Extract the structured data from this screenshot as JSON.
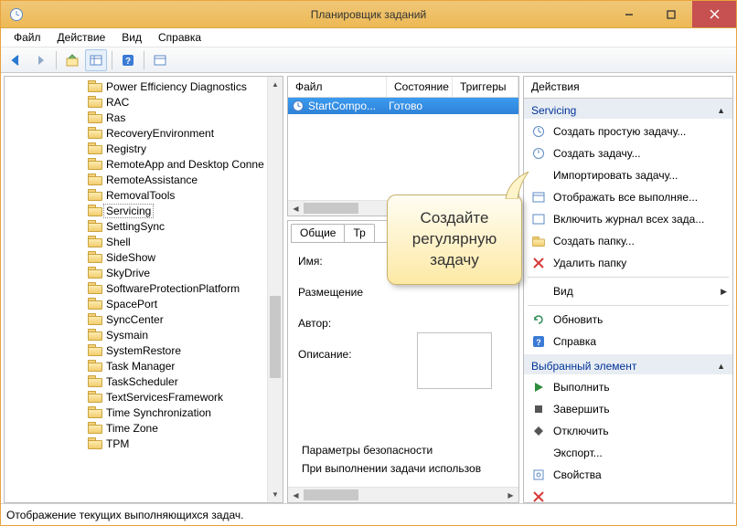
{
  "window": {
    "title": "Планировщик заданий"
  },
  "menu": {
    "file": "Файл",
    "action": "Действие",
    "view": "Вид",
    "help": "Справка"
  },
  "tree": {
    "items": [
      {
        "label": "Power Efficiency Diagnostics"
      },
      {
        "label": "RAC"
      },
      {
        "label": "Ras"
      },
      {
        "label": "RecoveryEnvironment"
      },
      {
        "label": "Registry"
      },
      {
        "label": "RemoteApp and Desktop Conne"
      },
      {
        "label": "RemoteAssistance"
      },
      {
        "label": "RemovalTools"
      },
      {
        "label": "Servicing",
        "selected": true
      },
      {
        "label": "SettingSync"
      },
      {
        "label": "Shell"
      },
      {
        "label": "SideShow"
      },
      {
        "label": "SkyDrive"
      },
      {
        "label": "SoftwareProtectionPlatform"
      },
      {
        "label": "SpacePort"
      },
      {
        "label": "SyncCenter"
      },
      {
        "label": "Sysmain"
      },
      {
        "label": "SystemRestore"
      },
      {
        "label": "Task Manager"
      },
      {
        "label": "TaskScheduler"
      },
      {
        "label": "TextServicesFramework"
      },
      {
        "label": "Time Synchronization"
      },
      {
        "label": "Time Zone"
      },
      {
        "label": "TPM"
      }
    ]
  },
  "task_list": {
    "columns": {
      "file": "Файл",
      "state": "Состояние",
      "triggers": "Триггеры"
    },
    "rows": [
      {
        "name": "StartCompo...",
        "state": "Готово"
      }
    ]
  },
  "tabs": {
    "general": "Общие",
    "triggers": "Тр"
  },
  "details": {
    "name_label": "Имя:",
    "location_label": "Размещение",
    "author_label": "Автор:",
    "description_label": "Описание:",
    "security_label": "Параметры безопасности",
    "security_sub": "При выполнении задачи использов"
  },
  "actions": {
    "header": "Действия",
    "group1": "Servicing",
    "group2": "Выбранный элемент",
    "g1": {
      "create_basic": "Создать простую задачу...",
      "create": "Создать задачу...",
      "import": "Импортировать задачу...",
      "show_running": "Отображать все выполняе...",
      "enable_history": "Включить журнал всех зада...",
      "new_folder": "Создать папку...",
      "delete_folder": "Удалить папку",
      "view": "Вид",
      "refresh": "Обновить",
      "help": "Справка"
    },
    "g2": {
      "run": "Выполнить",
      "end": "Завершить",
      "disable": "Отключить",
      "export": "Экспорт...",
      "properties": "Свойства"
    }
  },
  "callout": {
    "text": "Создайте регулярную задачу"
  },
  "status": {
    "text": "Отображение текущих выполняющихся задач."
  }
}
